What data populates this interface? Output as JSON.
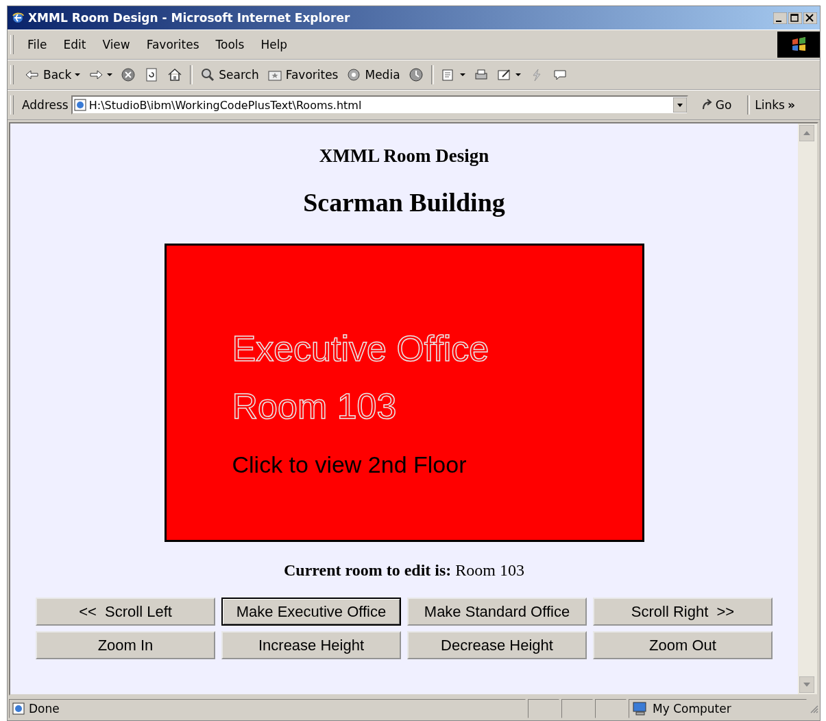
{
  "window": {
    "title": "XMML Room Design - Microsoft Internet Explorer"
  },
  "menu": [
    "File",
    "Edit",
    "View",
    "Favorites",
    "Tools",
    "Help"
  ],
  "toolbar": [
    {
      "kind": "back",
      "label": "Back",
      "dropdown": true
    },
    {
      "kind": "forward",
      "dropdown": true
    },
    {
      "kind": "stop",
      "dropdown": false
    },
    {
      "kind": "refresh",
      "dropdown": false
    },
    {
      "kind": "home",
      "dropdown": false
    },
    {
      "kind": "search",
      "label": "Search",
      "dropdown": false
    },
    {
      "kind": "favorites",
      "label": "Favorites",
      "dropdown": false
    },
    {
      "kind": "media",
      "label": "Media",
      "dropdown": false
    },
    {
      "kind": "history",
      "dropdown": false
    },
    {
      "kind": "mail",
      "dropdown": true
    },
    {
      "kind": "print",
      "dropdown": false
    },
    {
      "kind": "edit",
      "dropdown": true
    },
    {
      "kind": "messenger",
      "dropdown": false
    },
    {
      "kind": "discuss",
      "dropdown": false
    }
  ],
  "address": {
    "label": "Address",
    "value": "H:\\StudioB\\ibm\\WorkingCodePlusText\\Rooms.html",
    "go": "Go",
    "links": "Links",
    "more": "»"
  },
  "page": {
    "title": "XMML Room Design",
    "building": "Scarman Building",
    "room": {
      "type": "Executive Office",
      "name": "Room 103",
      "link": "Click to view 2nd Floor"
    },
    "current": "**Current room to edit is:** Room 103",
    "buttons": [
      {
        "label": "<<  Scroll Left",
        "focused": false
      },
      {
        "label": "Make Executive Office",
        "focused": true
      },
      {
        "label": "Make Standard Office",
        "focused": false
      },
      {
        "label": "Scroll Right  >>",
        "focused": false
      },
      {
        "label": "Zoom In",
        "focused": false
      },
      {
        "label": "Increase Height",
        "focused": false
      },
      {
        "label": "Decrease Height",
        "focused": false
      },
      {
        "label": "Zoom Out",
        "focused": false
      }
    ]
  },
  "status_bar": {
    "text": "Done",
    "zone": "My Computer"
  }
}
